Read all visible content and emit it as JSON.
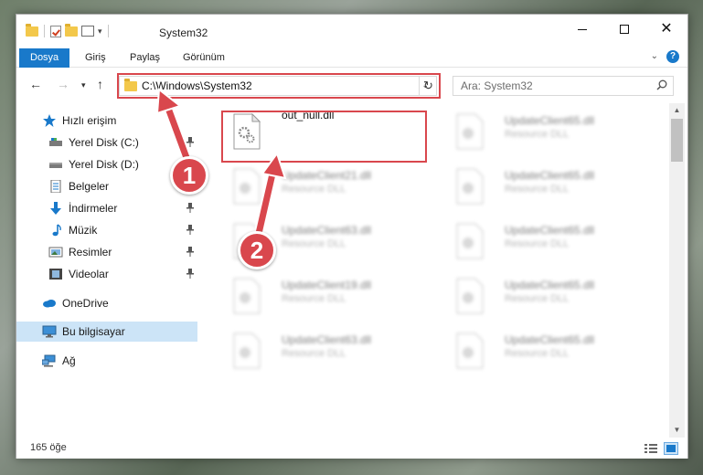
{
  "window": {
    "title": "System32"
  },
  "ribbon": {
    "tabs": [
      {
        "label": "Dosya",
        "active": true
      },
      {
        "label": "Giriş",
        "active": false
      },
      {
        "label": "Paylaş",
        "active": false
      },
      {
        "label": "Görünüm",
        "active": false
      }
    ]
  },
  "address": {
    "path": "C:\\Windows\\System32"
  },
  "search": {
    "placeholder": "Ara: System32"
  },
  "sidebar": {
    "items": [
      {
        "label": "Hızlı erişim",
        "icon": "star-icon",
        "pinned": false
      },
      {
        "label": "Yerel Disk (C:)",
        "icon": "drive-icon",
        "pinned": true
      },
      {
        "label": "Yerel Disk (D:)",
        "icon": "drive-icon",
        "pinned": false
      },
      {
        "label": "Belgeler",
        "icon": "documents-icon",
        "pinned": true
      },
      {
        "label": "İndirmeler",
        "icon": "download-icon",
        "pinned": true
      },
      {
        "label": "Müzik",
        "icon": "music-icon",
        "pinned": true
      },
      {
        "label": "Resimler",
        "icon": "pictures-icon",
        "pinned": true
      },
      {
        "label": "Videolar",
        "icon": "video-icon",
        "pinned": true
      },
      {
        "label": "OneDrive",
        "icon": "cloud-icon",
        "pinned": false
      },
      {
        "label": "Bu bilgisayar",
        "icon": "computer-icon",
        "pinned": false,
        "selected": true
      },
      {
        "label": "Ağ",
        "icon": "network-icon",
        "pinned": false
      }
    ]
  },
  "files": [
    {
      "name": "out_null.dll",
      "type": "",
      "blurred": false
    },
    {
      "name": "UpdateClient65.dll",
      "type": "Resource DLL",
      "blurred": true
    },
    {
      "name": "UpdateClient21.dll",
      "type": "Resource DLL",
      "blurred": true
    },
    {
      "name": "UpdateClient65.dll",
      "type": "Resource DLL",
      "blurred": true
    },
    {
      "name": "UpdateClient63.dll",
      "type": "Resource DLL",
      "blurred": true
    },
    {
      "name": "UpdateClient65.dll",
      "type": "Resource DLL",
      "blurred": true
    },
    {
      "name": "UpdateClient19.dll",
      "type": "Resource DLL",
      "blurred": true
    },
    {
      "name": "UpdateClient65.dll",
      "type": "Resource DLL",
      "blurred": true
    },
    {
      "name": "UpdateClient63.dll",
      "type": "Resource DLL",
      "blurred": true
    },
    {
      "name": "UpdateClient65.dll",
      "type": "Resource DLL",
      "blurred": true
    }
  ],
  "status": {
    "count": "165 öğe"
  },
  "callouts": [
    "1",
    "2"
  ],
  "colors": {
    "accent": "#1979ca",
    "highlight": "#d9474d",
    "selection": "#cce4f7"
  }
}
